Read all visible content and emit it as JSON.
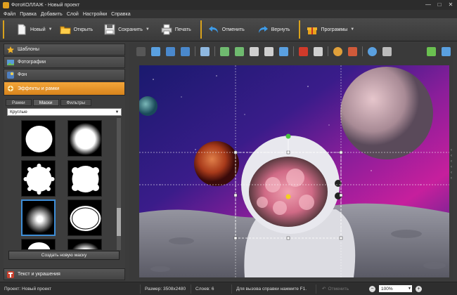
{
  "window": {
    "title": "ФотоКОЛЛАЖ - Новый проект",
    "controls": [
      "—",
      "□",
      "✕"
    ]
  },
  "menu": [
    "Файл",
    "Правка",
    "Добавить",
    "Слой",
    "Настройки",
    "Справка"
  ],
  "toolbar": {
    "new_label": "Новый",
    "open_label": "Открыть",
    "save_label": "Сохранить",
    "print_label": "Печать",
    "undo_label": "Отменить",
    "redo_label": "Вернуть",
    "programs_label": "Программы",
    "dropdown_glyph": "▼"
  },
  "left_panel": {
    "sections": {
      "templates": "Шаблоны",
      "photos": "Фотографии",
      "background": "Фон",
      "effects": "Эффекты и рамки",
      "text": "Текст и украшения"
    },
    "subtabs": [
      "Рамки",
      "Маски",
      "Фильтры"
    ],
    "active_subtab": "Маски",
    "mask_category": "Круглые",
    "create_mask_button": "Создать новую маску"
  },
  "status": {
    "project_label": "Проект:",
    "project_name": "Новый проект",
    "size_label": "Размер:",
    "size_value": "3508x2480",
    "layers_label": "Слоев:",
    "layers_value": "6",
    "help_hint": "Для вызова справки нажмите F1.",
    "undo_label": "Отменить",
    "zoom_value": "100%"
  },
  "colors": {
    "accent": "#d9a21c",
    "active_section": "#f0a035",
    "selection": "#3e8ed8"
  },
  "icons": {
    "new": "document-icon",
    "open": "folder-icon",
    "save": "disk-icon",
    "print": "printer-icon",
    "undo": "undo-arrow-icon",
    "redo": "redo-arrow-icon",
    "programs": "gift-box-icon"
  }
}
